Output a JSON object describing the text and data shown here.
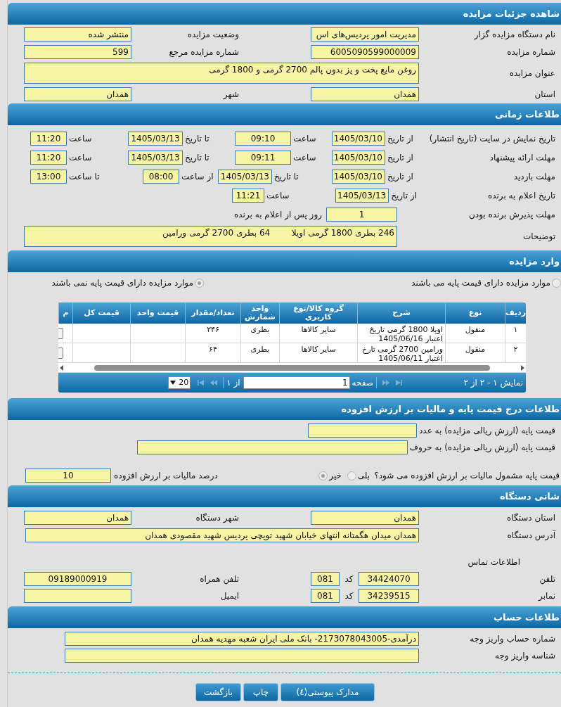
{
  "details": {
    "title": "شاهده جزئیات مزایده",
    "rows": [
      [
        {
          "label": "نام دستگاه مزایده گزار",
          "value": "مدیریت امور پردیس‌های اس",
          "kind": "line"
        },
        {
          "label": "وضعیت مزایده",
          "value": "منتشر شده",
          "kind": "line"
        }
      ],
      [
        {
          "label": "شماره مزایده",
          "value": "6005090599000009",
          "kind": "line"
        },
        {
          "label": "شماره مزایده مرجع",
          "value": "599",
          "kind": "line"
        }
      ],
      [
        {
          "label": "عنوان مزایده",
          "value": "روغن مایع پخت و پز بدون پالم 2700 گرمی و 1800 گرمی",
          "kind": "multiline"
        }
      ],
      [
        {
          "label": "استان",
          "value": "همدان",
          "kind": "line"
        },
        {
          "label": "شهر",
          "value": "همدان",
          "kind": "line"
        }
      ]
    ]
  },
  "timing": {
    "title": "طلاعات زمانی",
    "rows": [
      {
        "kind": "schedule",
        "label": "تاریخ نمایش در سایت (تاریخ انتشار)",
        "parts": [
          {
            "label": "از تاریخ",
            "value": "1405/03/10"
          },
          {
            "label": "ساعت",
            "value": "09:10"
          },
          {
            "label": "تا تاریخ",
            "value": "1405/03/13"
          },
          {
            "label": "ساعت",
            "value": "11:20"
          }
        ]
      },
      {
        "kind": "schedule",
        "label": "مهلت ارائه پیشنهاد",
        "parts": [
          {
            "label": "از تاریخ",
            "value": "1405/03/10"
          },
          {
            "label": "ساعت",
            "value": "09:11"
          },
          {
            "label": "تا تاریخ",
            "value": "1405/03/13"
          },
          {
            "label": "ساعت",
            "value": "11:20"
          }
        ]
      },
      {
        "kind": "schedule",
        "label": "مهلت بازدید",
        "parts": [
          {
            "label": "از تاریخ",
            "value": "1405/03/10"
          },
          {
            "label": "تا تاریخ",
            "value": "1405/03/13"
          },
          {
            "label": "از ساعت",
            "value": "08:00"
          },
          {
            "label": "تا ساعت",
            "value": "13:00"
          }
        ]
      },
      {
        "kind": "schedule",
        "label": "تاریخ اعلام به برنده",
        "parts": [
          {
            "label": "از تاریخ",
            "value": "1405/03/13"
          },
          {
            "label": "ساعت",
            "value": "11:21"
          }
        ]
      },
      {
        "kind": "days",
        "label": "مهلت پذیرش برنده بودن",
        "value": "1",
        "suffix": "روز پس از اعلام به برنده"
      },
      {
        "kind": "notes",
        "label": "توضیحات",
        "value": "246 بطری 1800 گرمی اویلا        64 بطری 2700 گرمی ورامین"
      }
    ]
  },
  "items": {
    "title": "وارد مزایده",
    "radios": [
      {
        "label": "موارد مزایده دارای قیمت پایه می باشند",
        "selected": false,
        "disabled": true
      },
      {
        "label": "موارد مزایده دارای قیمت پایه نمی باشند",
        "selected": true,
        "disabled": true
      }
    ],
    "table": {
      "columns": [
        "ردیف",
        "نوع",
        "شرح",
        "گروه کالا/نوع کاربری",
        "واحد شمارش",
        "تعداد/مقدار",
        "قیمت واحد",
        "قیمت کل",
        "م"
      ],
      "rows": [
        {
          "cells": [
            "۱",
            "منقول",
            "اویلا 1800 گرمی تاریخ اعتبار 1405/06/16",
            "سایر کالاها",
            "بطری",
            "۲۴۶"
          ]
        },
        {
          "cells": [
            "۲",
            "منقول",
            "ورامین 2700 گرمی تارخ اعتبار 1405/06/11",
            "سایر کالاها",
            "بطری",
            "۶۴"
          ]
        }
      ]
    },
    "pager": {
      "summary": "نمایش ۱ - ۲ از ۲",
      "page_label": "صفحه",
      "page": "1",
      "page_count": "از ۱",
      "page_size": "20"
    }
  },
  "tax": {
    "title": "طلاعات درج قیمت پایه و مالیات بر ارزش افزوده",
    "base_price_number": {
      "label": "قیمت پایه (ارزش ریالی مزایده) به عدد"
    },
    "base_price_words": {
      "label": "قیمت پایه (ارزش ریالی مزایده) به حروف"
    },
    "vat_question": {
      "label": "قیمت پایه مشمول مالیات بر ارزش افزوده می شود؟",
      "options": [
        {
          "label": "بلی",
          "selected": false,
          "disabled": true
        },
        {
          "label": "خیر",
          "selected": true,
          "disabled": true
        }
      ]
    },
    "vat_percent": {
      "label": "درصد مالیات بر ارزش افزوده",
      "value": "10"
    }
  },
  "device": {
    "title": "شانی دستگاه",
    "rows": [
      [
        {
          "label": "استان دستگاه",
          "value": "همدان"
        },
        {
          "label": "شهر دستگاه",
          "value": "همدان"
        }
      ],
      [
        {
          "label": "آدرس دستگاه",
          "value": "همدان میدان هگمتانه انتهای خیابان شهید توپچی پردیس شهید مقصودی همدان"
        }
      ]
    ],
    "contact_title": "اطلاعات تماس",
    "contact_rows": [
      {
        "phone": {
          "label": "تلفن",
          "value": "34424070",
          "code_label": "کد",
          "code": "081"
        },
        "other": {
          "label": "تلفن همراه",
          "value": "09189000919"
        }
      },
      {
        "phone": {
          "label": "نمابر",
          "value": "34239515",
          "code_label": "کد",
          "code": "081"
        },
        "other": {
          "label": "ایمیل"
        }
      }
    ]
  },
  "account": {
    "title": "طلاعات حساب",
    "fields": [
      {
        "label": "شماره حساب واریز وجه",
        "value": "درآمدی-2173078043005- بانک ملی ایران شعبه مهدیه همدان"
      },
      {
        "label": "شناسه واریز وجه"
      }
    ]
  },
  "buttons": [
    {
      "label": "مدارک پیوستی(٤)"
    },
    {
      "label": "چاپ"
    },
    {
      "label": "بازگشت"
    }
  ]
}
